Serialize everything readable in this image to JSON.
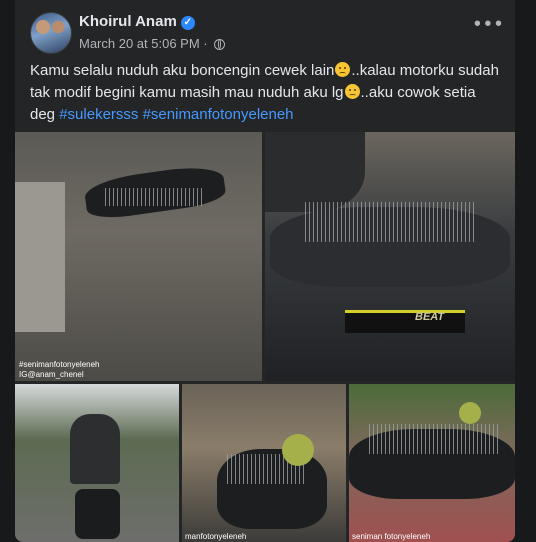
{
  "post": {
    "author": "Khoirul Anam",
    "timestamp": "March 20 at 5:06 PM",
    "separator": "·",
    "body_text_1": "Kamu selalu nuduh aku boncengin  cewek lain",
    "body_text_2": "..kalau motorku sudah tak modif begini kamu masih mau nuduh aku lg",
    "body_text_3": "..aku cowok setia deg ",
    "hashtags": [
      "#sulekersss",
      "#senimanfotonyeleneh"
    ],
    "icons": {
      "verified": "verified-badge-icon",
      "audience": "globe-icon",
      "more": "more-options-icon"
    },
    "colors": {
      "hashtag": "#4599ff",
      "verified": "#2d88ff"
    }
  },
  "photos": {
    "p1_watermark_1": "#senimanfotonyeleneh",
    "p1_watermark_2": "IG@anam_chenel",
    "p4_watermark": "manfotonyeleneh",
    "p5_watermark": "seniman fotonyeleneh",
    "p2_scooter_label": "BEAT"
  }
}
